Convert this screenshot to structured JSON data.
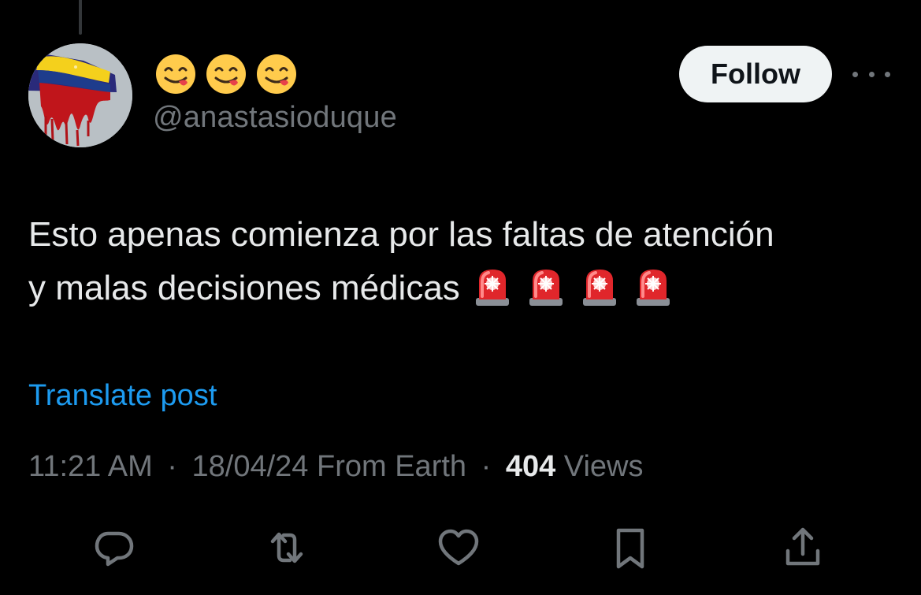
{
  "author": {
    "display_name_emojis": [
      "face-savoring-food-emoji",
      "face-savoring-food-emoji",
      "face-savoring-food-emoji"
    ],
    "handle": "@anastasioduque",
    "avatar": "bleeding-venezuela-flag-avatar"
  },
  "header": {
    "follow_label": "Follow",
    "more_icon": "more-horizontal-icon"
  },
  "post": {
    "line1": "Esto apenas comienza por las faltas de atención",
    "line2": "y malas decisiones médicas",
    "emojis": [
      "police-light-emoji",
      "police-light-emoji",
      "police-light-emoji",
      "police-light-emoji"
    ],
    "translate_label": "Translate post"
  },
  "meta": {
    "time": "11:21 AM",
    "separator": "·",
    "date": "18/04/24",
    "source": "From Earth",
    "views_count": "404",
    "views_label": "Views"
  },
  "actions": [
    {
      "name": "reply",
      "icon": "reply-icon"
    },
    {
      "name": "repost",
      "icon": "repost-icon"
    },
    {
      "name": "like",
      "icon": "heart-icon"
    },
    {
      "name": "bookmark",
      "icon": "bookmark-icon"
    },
    {
      "name": "share",
      "icon": "share-icon"
    }
  ],
  "colors": {
    "background": "#000000",
    "primary_text": "#e7e9ea",
    "secondary_text": "#71767b",
    "link": "#1d9bf0",
    "follow_bg": "#eff3f4",
    "follow_text": "#0f1419"
  }
}
